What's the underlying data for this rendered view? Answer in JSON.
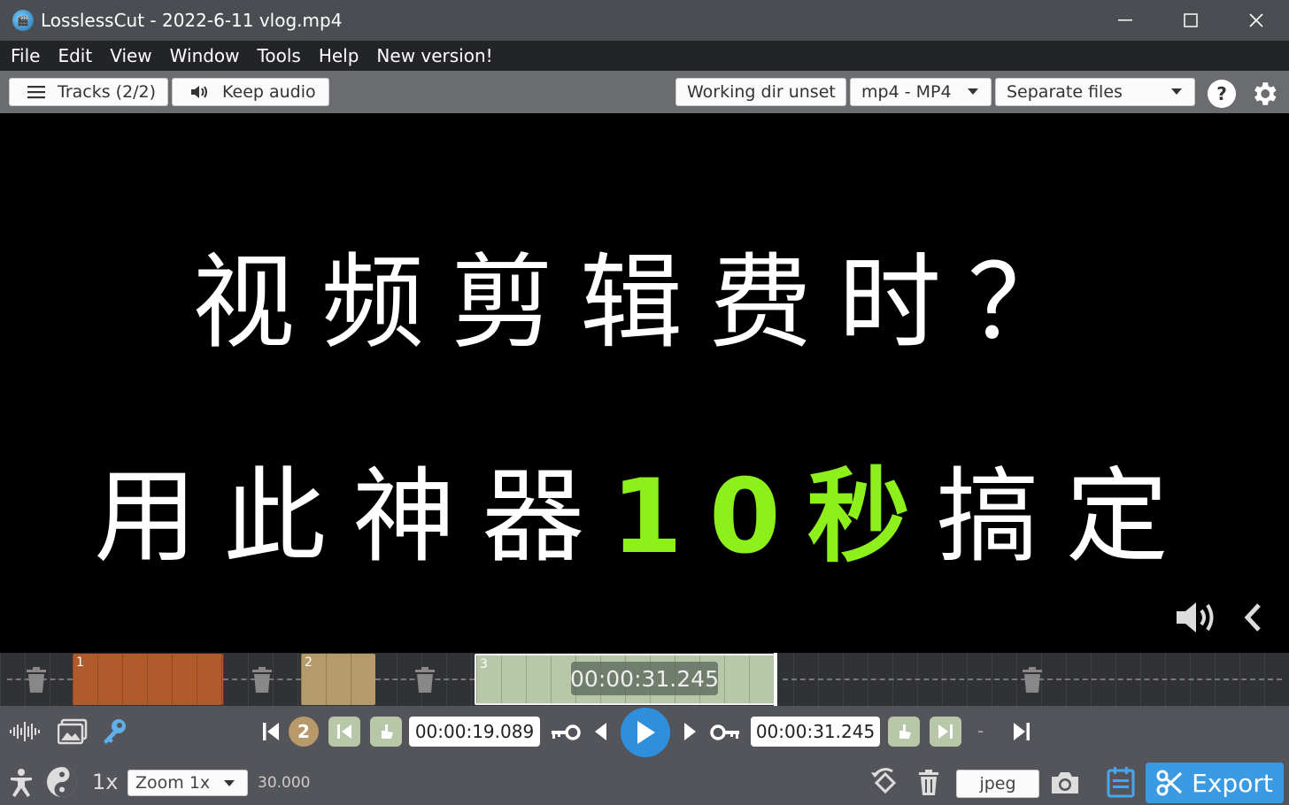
{
  "window": {
    "title": "LosslessCut - 2022-6-11 vlog.mp4",
    "controls": {
      "minimize": "—",
      "maximize": "☐",
      "close": "✕"
    }
  },
  "menu": [
    "File",
    "Edit",
    "View",
    "Window",
    "Tools",
    "Help",
    "New version!"
  ],
  "toolbar": {
    "tracks_label": "Tracks (2/2)",
    "audio_label": "Keep audio",
    "working_dir": "Working dir unset",
    "format": "mp4 - MP4",
    "output_mode": "Separate files",
    "help": "?"
  },
  "video": {
    "line1": "视频剪辑费时？",
    "line2_before": "用此神器",
    "line2_highlight": "10秒",
    "line2_after": "搞定"
  },
  "timeline": {
    "segments": [
      {
        "number": "1",
        "color": "#b15a2c"
      },
      {
        "number": "2",
        "color": "#b59a6b"
      },
      {
        "number": "3",
        "color": "#b7c7a7"
      }
    ],
    "current_time": "00:00:31.245"
  },
  "controls": {
    "segment_badge": "2",
    "start_time": "00:00:19.089",
    "end_time": "00:00:31.245",
    "separator": "-",
    "speed": "1x",
    "zoom": "Zoom 1x",
    "fps": "30.000",
    "capture_format": "jpeg",
    "export_label": "Export"
  },
  "colors": {
    "accent": "#3a9be2",
    "highlight_text": "#8ef01a"
  }
}
